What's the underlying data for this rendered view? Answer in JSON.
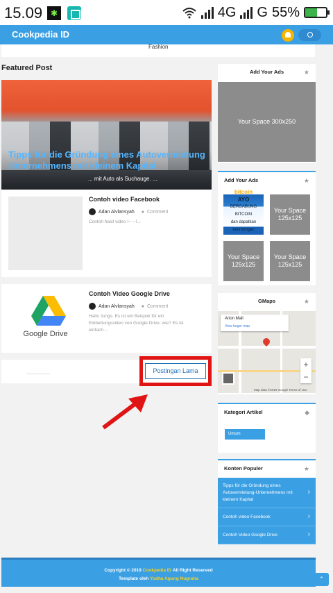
{
  "status_bar": {
    "time": "15.09",
    "network1": "4G",
    "network2": "G",
    "battery": "55%",
    "battery_level": 0.55
  },
  "header": {
    "brand": "Cookpedia ID"
  },
  "category_strip": {
    "label": "Fashion"
  },
  "main": {
    "section_title": "Featured Post",
    "featured": {
      "title": "Tipps für die Gründung eines Autovermietung Unternehmens mit kleinem Kapital",
      "excerpt": "... mit Auto als Suchauge. ..."
    },
    "posts": [
      {
        "title": "Contoh video Facebook",
        "author": "Adan Alvlansyah",
        "comment": "Comment",
        "excerpt": "Contoh hasil video !-- --!..."
      },
      {
        "title": "Contoh Video Google Drive",
        "author": "Adan Alvlansyah",
        "comment": "Comment",
        "excerpt": "Hallo Jungs. Es ist ein Beispiel für ein Einbettungsvideo von Google Drive. wie? Es ist einfach...",
        "thumb_label": "Google Drive"
      }
    ],
    "older_button": "Postingan Lama",
    "accent_colors": {
      "primary": "#3a9fe3",
      "annotation": "#e01414"
    }
  },
  "sidebar": {
    "ads1": {
      "title": "Add Your Ads",
      "box_label": "Your Space 300x250",
      "icon": "star-icon"
    },
    "ads2": {
      "title": "Add Your Ads",
      "icon": "star-icon",
      "bitcoin": {
        "brand": "bitcoin",
        "head": "AYO",
        "line1": "BERGABUNG BITCOIN",
        "line2": "dan dapatkan keuntungan",
        "cta": "GABUNG BITCOIN"
      },
      "slots": [
        "Your Space 125x125",
        "Your Space 125x125",
        "Your Space 125x125"
      ]
    },
    "gmaps": {
      "title": "GMaps",
      "place": "Arion Mall",
      "link": "View larger map",
      "footer": "Map data ©2019 Google   Terms of Use",
      "zoom_in": "+",
      "zoom_out": "−"
    },
    "kategori": {
      "title": "Kategori Artikel",
      "button": "Umum",
      "icon": "tags-icon"
    },
    "populer": {
      "title": "Konten Populer",
      "items": [
        "Tipps für die Gründung eines Autovermietung-Unternehmens mit kleinem Kapital",
        "Contoh video Facebook",
        "Contoh Video Google Drive"
      ]
    }
  },
  "footer": {
    "copyright_pre": "Copyright © 2019",
    "brand": "Cookpedia ID",
    "copyright_post": "All Right Reserved",
    "template_pre": "Template oleh",
    "author": "Yudha Agung Nugraha"
  }
}
